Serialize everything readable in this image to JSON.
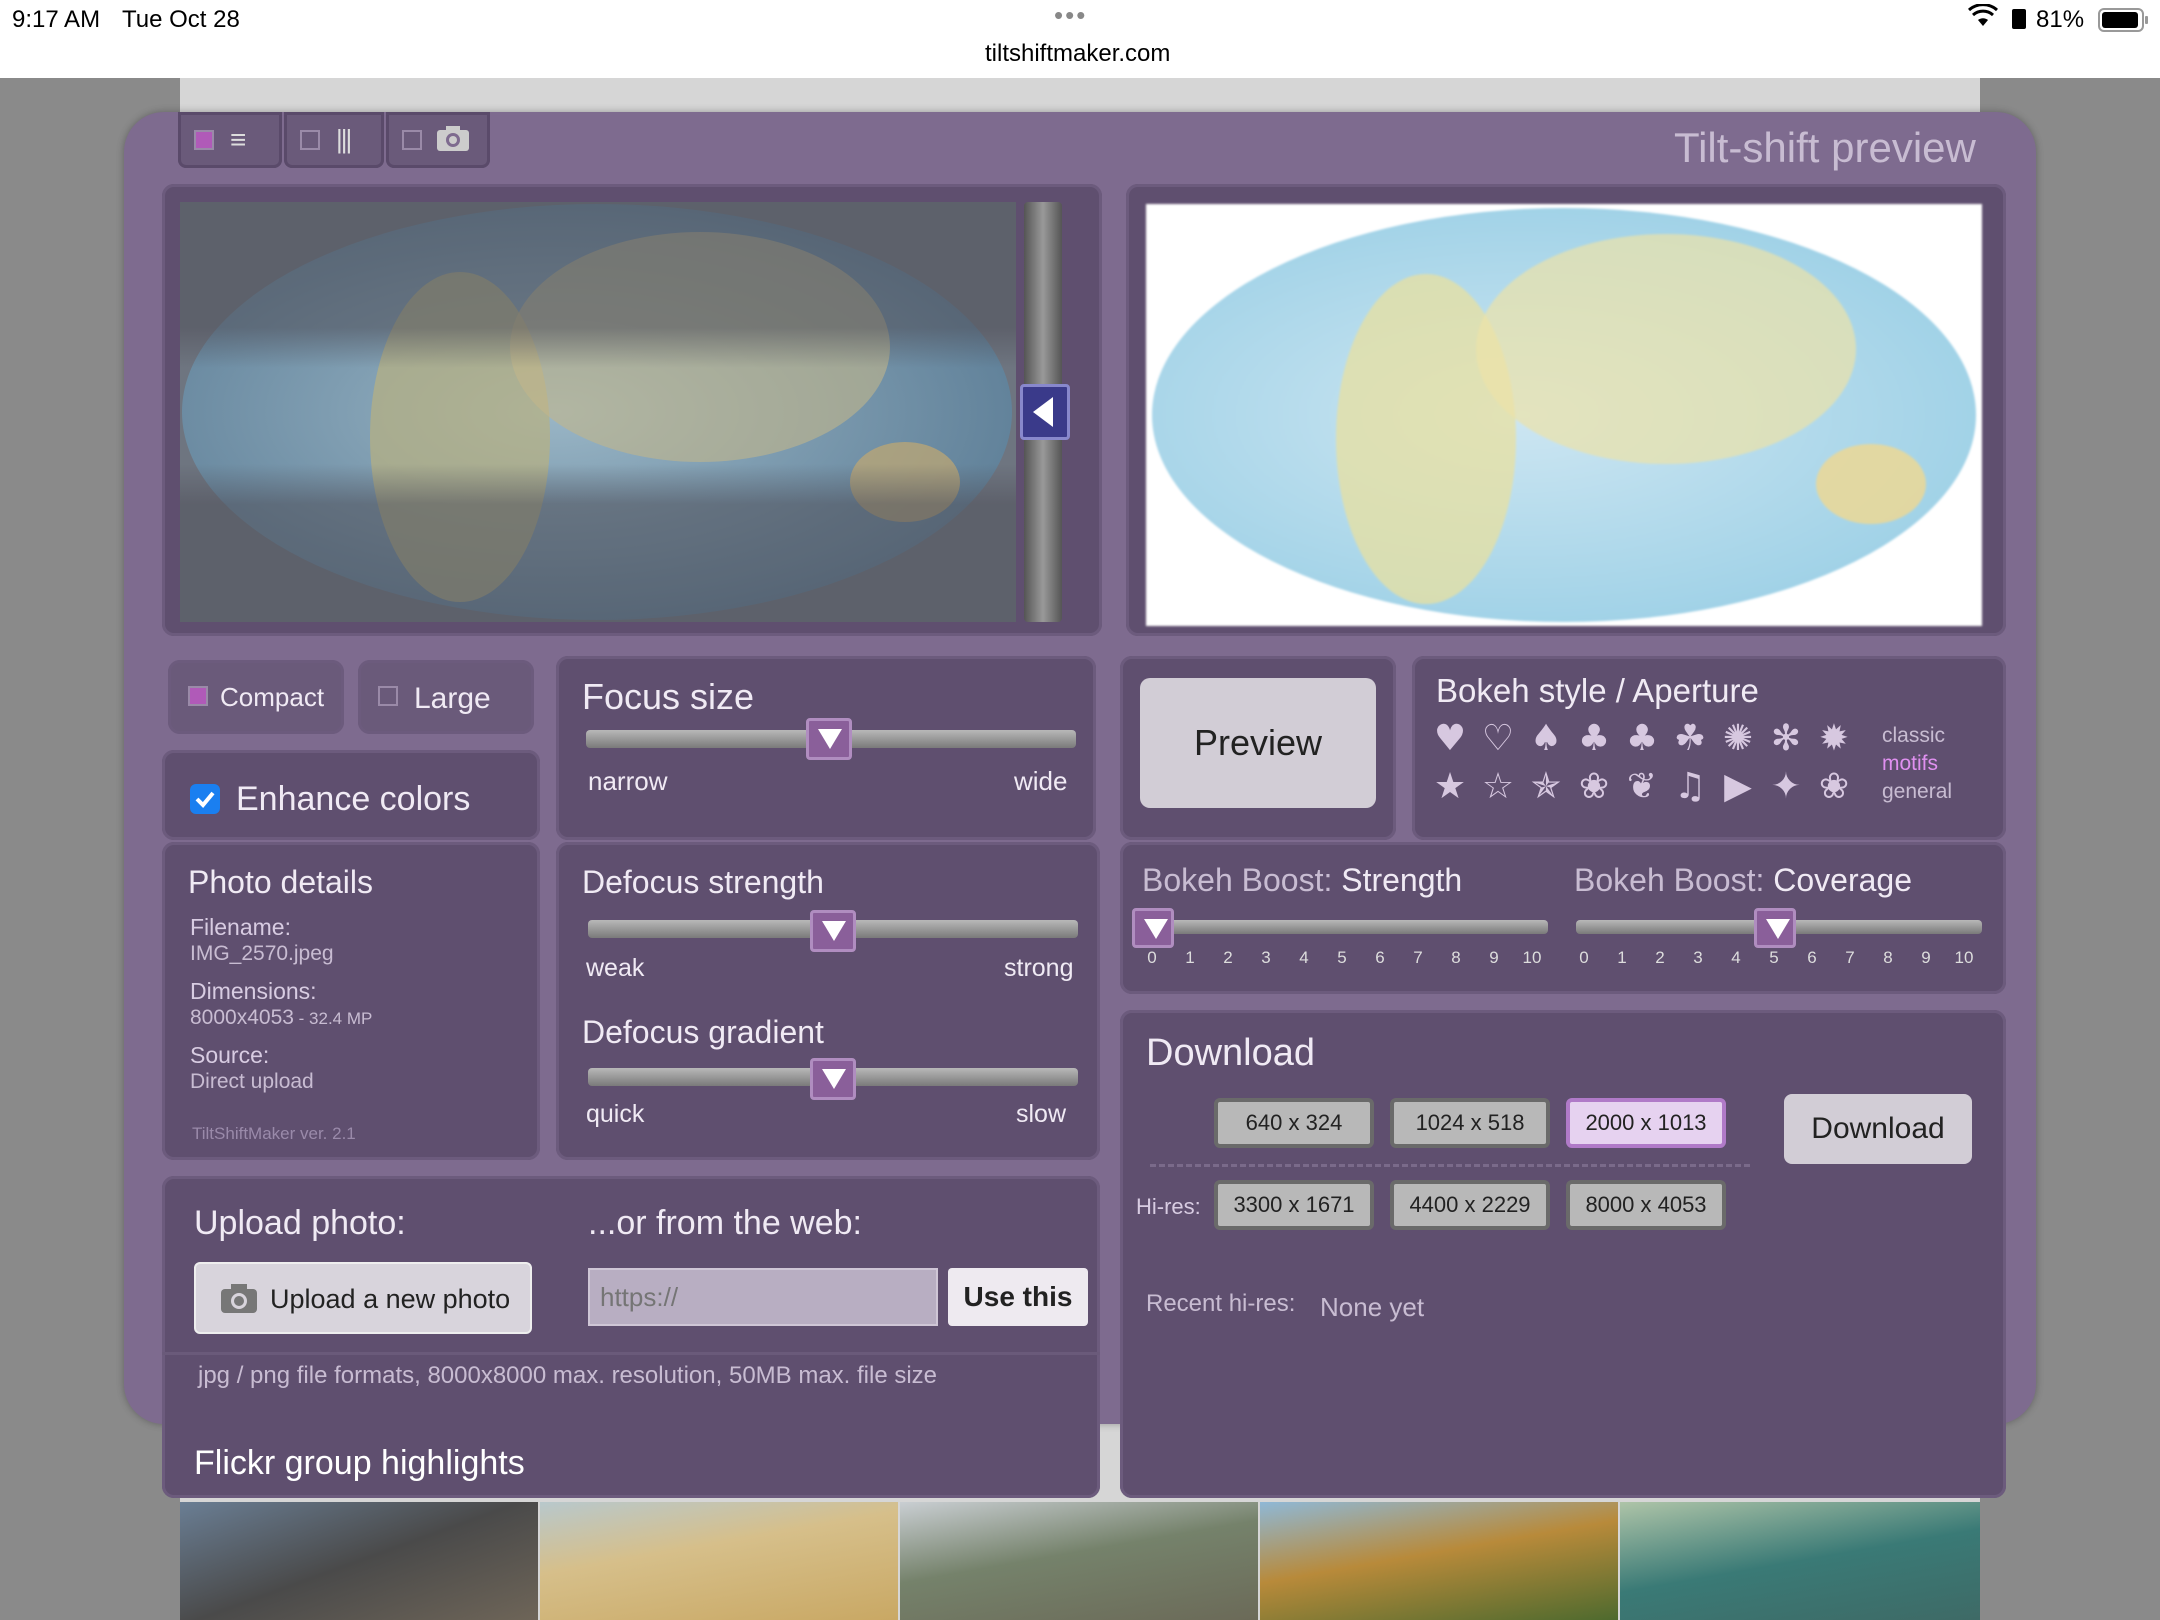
{
  "status_bar": {
    "time": "9:17 AM",
    "date": "Tue Oct 28",
    "url": "tiltshiftmaker.com",
    "battery": "81%",
    "more_dots": "•••"
  },
  "header": {
    "title": "Tilt-shift preview",
    "view_tabs": [
      "list-view-icon",
      "columns-view-icon",
      "camera-view-icon"
    ]
  },
  "layout_options": {
    "compact": "Compact",
    "large": "Large",
    "enhance_colors": "Enhance colors",
    "enhance_checked": true
  },
  "focus_size": {
    "title": "Focus size",
    "min": "narrow",
    "max": "wide",
    "value": 0.5
  },
  "preview_button": "Preview",
  "bokeh_style": {
    "title": "Bokeh style / Aperture",
    "shapes_row1": [
      "♥",
      "♡",
      "♠",
      "♣",
      "♣",
      "☘",
      "✺",
      "✻",
      "✹"
    ],
    "shapes_row2": [
      "★",
      "☆",
      "✯",
      "❀",
      "❦",
      "♫",
      "▶",
      "✦",
      "❀"
    ],
    "categories": [
      "classic",
      "motifs",
      "general"
    ],
    "active_category": "motifs"
  },
  "photo_details": {
    "title": "Photo details",
    "filename_label": "Filename:",
    "filename": "IMG_2570.jpeg",
    "dimensions_label": "Dimensions:",
    "dimensions": "8000x4053",
    "megapixels": " - 32.4 MP",
    "source_label": "Source:",
    "source": "Direct upload",
    "version": "TiltShiftMaker ver. 2.1"
  },
  "defocus_strength": {
    "title": "Defocus strength",
    "min": "weak",
    "max": "strong",
    "value": 0.5
  },
  "defocus_gradient": {
    "title": "Defocus gradient",
    "min": "quick",
    "max": "slow",
    "value": 0.5
  },
  "bokeh_boost_strength": {
    "title_a": "Bokeh Boost: ",
    "title_b": "Strength",
    "ticks": [
      "0",
      "1",
      "2",
      "3",
      "4",
      "5",
      "6",
      "7",
      "8",
      "9",
      "10"
    ],
    "value": 0
  },
  "bokeh_boost_coverage": {
    "title_a": "Bokeh Boost: ",
    "title_b": "Coverage",
    "ticks": [
      "0",
      "1",
      "2",
      "3",
      "4",
      "5",
      "6",
      "7",
      "8",
      "9",
      "10"
    ],
    "value": 5
  },
  "download": {
    "title": "Download",
    "sizes": [
      "640 x 324",
      "1024 x 518",
      "2000 x 1013"
    ],
    "selected_size": "2000 x 1013",
    "hires_label": "Hi-res:",
    "hires_sizes": [
      "3300 x 1671",
      "4400 x 2229",
      "8000 x 4053"
    ],
    "button": "Download",
    "recent_label": "Recent hi-res:",
    "recent_value": "None yet"
  },
  "upload": {
    "title": "Upload photo:",
    "button": "Upload a new photo",
    "web_title": "...or from the web:",
    "url_placeholder": "https://",
    "use_button": "Use this",
    "note": "jpg / png file formats, 8000x8000 max. resolution, 50MB max. file size"
  },
  "flickr": {
    "title": "Flickr group highlights"
  },
  "colors": {
    "app_bg": "#7e6b8f",
    "panel_bg": "#5f4f6f",
    "accent": "#b05ab8",
    "selected_size_bg": "#e6d2f0"
  }
}
